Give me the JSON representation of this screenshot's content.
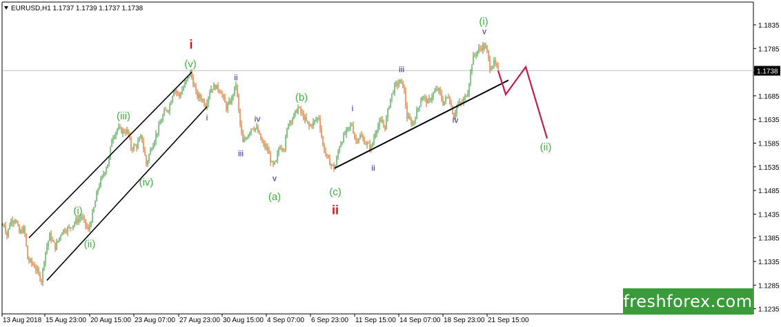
{
  "chart_data": {
    "type": "candlestick",
    "title": "EURUSD,H1  1.1737 1.1739 1.1737 1.1738",
    "current_price": "1.1738",
    "ylim": [
      1.1225,
      1.1885
    ],
    "y_ticks": [
      "1.1835",
      "1.1785",
      "1.1735",
      "1.1685",
      "1.1635",
      "1.1585",
      "1.1535",
      "1.1485",
      "1.1435",
      "1.1385",
      "1.1335",
      "1.1285",
      "1.1235"
    ],
    "x_ticks": [
      "13 Aug 2018",
      "15 Aug 23:00",
      "20 Aug 15:00",
      "23 Aug 07:00",
      "27 Aug 23:00",
      "30 Aug 15:00",
      "4 Sep 07:00",
      "6 Sep 23:00",
      "11 Sep 15:00",
      "14 Sep 07:00",
      "18 Sep 23:00",
      "21 Sep 15:00"
    ],
    "colors": {
      "up": "#3a9b3a",
      "down": "#e06010",
      "forecast": "#c8184a",
      "green": "#3cb43c",
      "red": "#e01010",
      "navy": "#2828a0"
    },
    "price_path": [
      [
        0,
        1.1375
      ],
      [
        5,
        1.142
      ],
      [
        10,
        1.139
      ],
      [
        15,
        1.142
      ],
      [
        22,
        1.1425
      ],
      [
        28,
        1.1395
      ],
      [
        35,
        1.1405
      ],
      [
        40,
        1.134
      ],
      [
        50,
        1.1325
      ],
      [
        60,
        1.1295
      ],
      [
        65,
        1.135
      ],
      [
        72,
        1.139
      ],
      [
        80,
        1.1365
      ],
      [
        90,
        1.14
      ],
      [
        100,
        1.1405
      ],
      [
        110,
        1.142
      ],
      [
        118,
        1.143
      ],
      [
        128,
        1.14
      ],
      [
        135,
        1.144
      ],
      [
        142,
        1.149
      ],
      [
        150,
        1.152
      ],
      [
        158,
        1.155
      ],
      [
        162,
        1.1595
      ],
      [
        170,
        1.1615
      ],
      [
        178,
        1.161
      ],
      [
        185,
        1.161
      ],
      [
        190,
        1.1575
      ],
      [
        198,
        1.158
      ],
      [
        205,
        1.16
      ],
      [
        212,
        1.154
      ],
      [
        218,
        1.157
      ],
      [
        228,
        1.161
      ],
      [
        238,
        1.165
      ],
      [
        245,
        1.166
      ],
      [
        252,
        1.17
      ],
      [
        260,
        1.1685
      ],
      [
        268,
        1.171
      ],
      [
        276,
        1.1735
      ],
      [
        285,
        1.1685
      ],
      [
        292,
        1.168
      ],
      [
        298,
        1.1665
      ],
      [
        305,
        1.17
      ],
      [
        312,
        1.1705
      ],
      [
        320,
        1.1695
      ],
      [
        328,
        1.166
      ],
      [
        335,
        1.1675
      ],
      [
        342,
        1.171
      ],
      [
        348,
        1.1625
      ],
      [
        352,
        1.1585
      ],
      [
        358,
        1.16
      ],
      [
        365,
        1.162
      ],
      [
        372,
        1.1615
      ],
      [
        380,
        1.1585
      ],
      [
        388,
        1.157
      ],
      [
        395,
        1.1535
      ],
      [
        400,
        1.1545
      ],
      [
        405,
        1.158
      ],
      [
        412,
        1.1575
      ],
      [
        418,
        1.163
      ],
      [
        425,
        1.164
      ],
      [
        432,
        1.166
      ],
      [
        440,
        1.164
      ],
      [
        448,
        1.162
      ],
      [
        455,
        1.163
      ],
      [
        462,
        1.164
      ],
      [
        468,
        1.158
      ],
      [
        475,
        1.155
      ],
      [
        485,
        1.153
      ],
      [
        492,
        1.158
      ],
      [
        500,
        1.1605
      ],
      [
        510,
        1.1625
      ],
      [
        515,
        1.159
      ],
      [
        522,
        1.16
      ],
      [
        530,
        1.1585
      ],
      [
        538,
        1.1575
      ],
      [
        545,
        1.1615
      ],
      [
        552,
        1.163
      ],
      [
        558,
        1.162
      ],
      [
        565,
        1.1675
      ],
      [
        572,
        1.1705
      ],
      [
        580,
        1.1715
      ],
      [
        585,
        1.1705
      ],
      [
        590,
        1.164
      ],
      [
        598,
        1.1625
      ],
      [
        605,
        1.1655
      ],
      [
        612,
        1.1685
      ],
      [
        620,
        1.167
      ],
      [
        628,
        1.169
      ],
      [
        635,
        1.17
      ],
      [
        642,
        1.167
      ],
      [
        650,
        1.1685
      ],
      [
        658,
        1.164
      ],
      [
        662,
        1.1665
      ],
      [
        670,
        1.167
      ],
      [
        678,
        1.1695
      ],
      [
        685,
        1.1765
      ],
      [
        692,
        1.178
      ],
      [
        700,
        1.179
      ],
      [
        705,
        1.1785
      ],
      [
        710,
        1.1745
      ],
      [
        716,
        1.1755
      ],
      [
        722,
        1.1738
      ]
    ],
    "forecast_path": [
      [
        722,
        1.1738
      ],
      [
        733,
        1.1688
      ],
      [
        762,
        1.1746
      ],
      [
        793,
        1.1595
      ]
    ],
    "channel_lines": [
      [
        [
          42,
          1.1385
        ],
        [
          278,
          1.1735
        ]
      ],
      [
        [
          68,
          1.1295
        ],
        [
          300,
          1.1662
        ]
      ]
    ],
    "support_line": [
      [
        485,
        1.1532
      ],
      [
        737,
        1.1718
      ]
    ],
    "wave_labels": [
      {
        "text": "i",
        "x": 277,
        "y": 1.1785,
        "color": "red",
        "size": 18
      },
      {
        "text": "(v)",
        "x": 276,
        "y": 1.1745,
        "color": "green",
        "size": 15
      },
      {
        "text": "(iii)",
        "x": 179,
        "y": 1.1635,
        "color": "green",
        "size": 15
      },
      {
        "text": "(iv)",
        "x": 212,
        "y": 1.1495,
        "color": "green",
        "size": 15
      },
      {
        "text": "(i)",
        "x": 113,
        "y": 1.1435,
        "color": "green",
        "size": 15
      },
      {
        "text": "(ii)",
        "x": 130,
        "y": 1.1365,
        "color": "green",
        "size": 15
      },
      {
        "text": "i",
        "x": 300,
        "y": 1.1633,
        "color": "navy",
        "size": 12
      },
      {
        "text": "ii",
        "x": 342,
        "y": 1.1718,
        "color": "navy",
        "size": 12
      },
      {
        "text": "iii",
        "x": 349,
        "y": 1.1557,
        "color": "navy",
        "size": 12
      },
      {
        "text": "iv",
        "x": 373,
        "y": 1.163,
        "color": "navy",
        "size": 12
      },
      {
        "text": "v",
        "x": 398,
        "y": 1.1505,
        "color": "navy",
        "size": 12
      },
      {
        "text": "(a)",
        "x": 398,
        "y": 1.1465,
        "color": "green",
        "size": 15
      },
      {
        "text": "(b)",
        "x": 437,
        "y": 1.1675,
        "color": "green",
        "size": 15
      },
      {
        "text": "(c)",
        "x": 486,
        "y": 1.1475,
        "color": "green",
        "size": 15
      },
      {
        "text": "ii",
        "x": 486,
        "y": 1.1435,
        "color": "red",
        "size": 18
      },
      {
        "text": "i",
        "x": 511,
        "y": 1.1653,
        "color": "navy",
        "size": 12
      },
      {
        "text": "ii",
        "x": 541,
        "y": 1.1527,
        "color": "navy",
        "size": 12
      },
      {
        "text": "iii",
        "x": 582,
        "y": 1.1735,
        "color": "navy",
        "size": 12
      },
      {
        "text": "iv",
        "x": 660,
        "y": 1.1628,
        "color": "navy",
        "size": 12
      },
      {
        "text": "v",
        "x": 702,
        "y": 1.1815,
        "color": "navy",
        "size": 12
      },
      {
        "text": "(i)",
        "x": 701,
        "y": 1.1835,
        "color": "green",
        "size": 15
      },
      {
        "text": "(ii)",
        "x": 791,
        "y": 1.157,
        "color": "green",
        "size": 15
      }
    ]
  },
  "branding": {
    "logo_text": "freshforex.com"
  }
}
